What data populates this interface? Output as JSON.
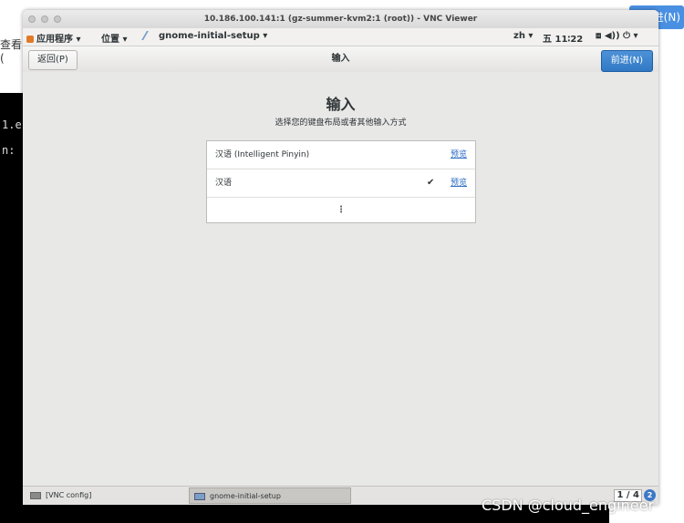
{
  "background": {
    "left_text": "查看(",
    "term_line1": "1.e",
    "term_line2": "n:",
    "right_button_label": "进(N)"
  },
  "vnc": {
    "title": "10.186.100.141:1 (gz-summer-kvm2:1 (root)) - VNC Viewer"
  },
  "gnome_bar": {
    "applications": "应用程序 ▾",
    "places": "位置 ▾",
    "app_menu": "gnome-initial-setup ▾",
    "lang": "zh ▾",
    "clock": "五 11∶22",
    "system_icons": "⧈ ◀)) ⏻ ▾"
  },
  "header": {
    "back_label": "返回(P)",
    "title": "输入",
    "next_label": "前进(N)"
  },
  "page": {
    "title": "输入",
    "subtitle": "选择您的键盘布局或者其他输入方式"
  },
  "input_sources": [
    {
      "label": "汉语 (Intelligent Pinyin)",
      "checked": false,
      "check": "",
      "preview": "预览"
    },
    {
      "label": "汉语",
      "checked": true,
      "check": "✔",
      "preview": "预览"
    }
  ],
  "more_label": "⋮",
  "taskbar": {
    "task1": "[VNC config]",
    "task2": "gnome-initial-setup",
    "workspace": "1 / 4",
    "badge": "2"
  },
  "watermark": "CSDN @cloud_engineer"
}
